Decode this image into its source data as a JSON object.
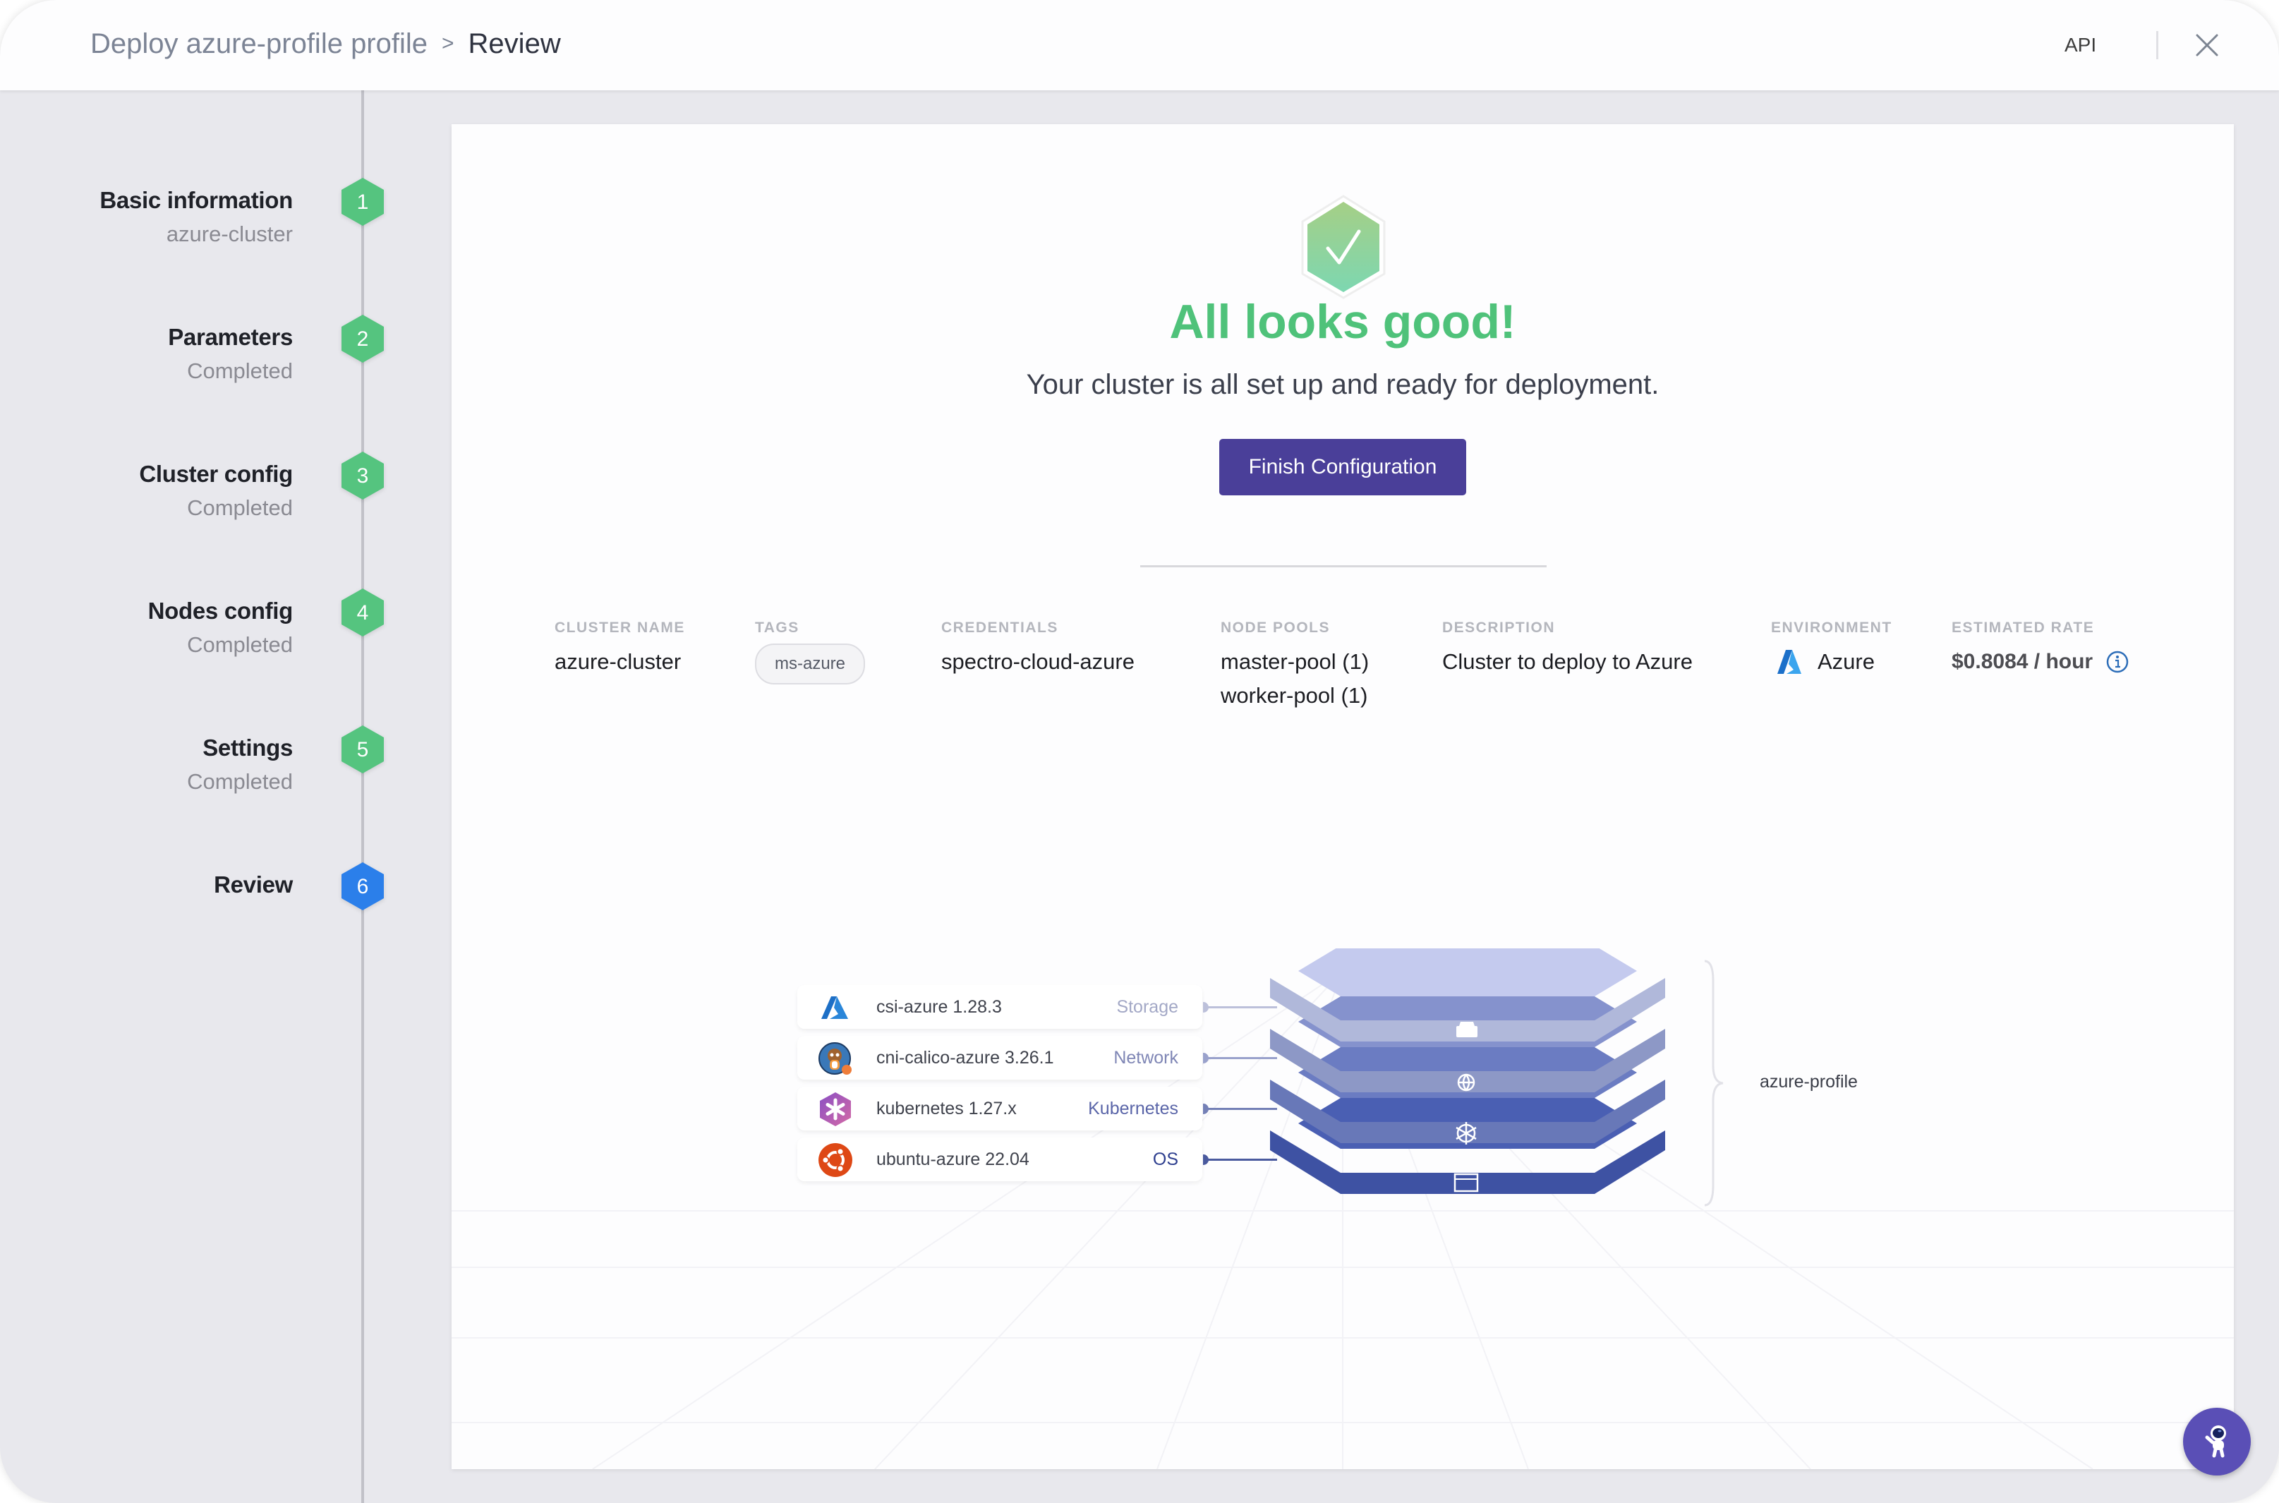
{
  "header": {
    "breadcrumb_parent": "Deploy azure-profile profile",
    "breadcrumb_separator": ">",
    "breadcrumb_current": "Review",
    "api_label": "API",
    "close_icon": "close-icon"
  },
  "steps": [
    {
      "number": "1",
      "title": "Basic information",
      "subtitle": "azure-cluster",
      "status": "completed"
    },
    {
      "number": "2",
      "title": "Parameters",
      "subtitle": "Completed",
      "status": "completed"
    },
    {
      "number": "3",
      "title": "Cluster config",
      "subtitle": "Completed",
      "status": "completed"
    },
    {
      "number": "4",
      "title": "Nodes config",
      "subtitle": "Completed",
      "status": "completed"
    },
    {
      "number": "5",
      "title": "Settings",
      "subtitle": "Completed",
      "status": "completed"
    },
    {
      "number": "6",
      "title": "Review",
      "subtitle": "",
      "status": "active"
    }
  ],
  "colors": {
    "step_completed": "#55c47f",
    "step_active": "#2b7fea",
    "success_green": "#4fc27a",
    "primary_button": "#4a3f99",
    "fab": "#5a4fb6"
  },
  "review": {
    "title": "All looks good!",
    "subtitle": "Your cluster is all set up and ready for deployment.",
    "finish_button": "Finish Configuration"
  },
  "summary": {
    "cluster_name": {
      "label": "CLUSTER NAME",
      "value": "azure-cluster"
    },
    "tags": {
      "label": "TAGS",
      "values": [
        "ms-azure"
      ]
    },
    "credentials": {
      "label": "CREDENTIALS",
      "value": "spectro-cloud-azure"
    },
    "node_pools": {
      "label": "NODE POOLS",
      "values": [
        "master-pool (1)",
        "worker-pool (1)"
      ]
    },
    "description": {
      "label": "DESCRIPTION",
      "value": "Cluster to deploy to Azure"
    },
    "environment": {
      "label": "ENVIRONMENT",
      "value": "Azure",
      "icon": "azure-logo-icon"
    },
    "estimated_rate": {
      "label": "ESTIMATED RATE",
      "value": "$0.8084 / hour",
      "icon": "info-icon"
    }
  },
  "profile": {
    "name": "azure-profile",
    "layers": [
      {
        "name": "csi-azure 1.28.3",
        "type": "Storage",
        "icon": "azure-icon",
        "type_color": "#a3a8c6"
      },
      {
        "name": "cni-calico-azure 3.26.1",
        "type": "Network",
        "icon": "calico-icon",
        "type_color": "#7f86b5"
      },
      {
        "name": "kubernetes 1.27.x",
        "type": "Kubernetes",
        "icon": "kubernetes-hex-icon",
        "type_color": "#5a65a8"
      },
      {
        "name": "ubuntu-azure 22.04",
        "type": "OS",
        "icon": "ubuntu-icon",
        "type_color": "#2e3f8f"
      }
    ]
  }
}
